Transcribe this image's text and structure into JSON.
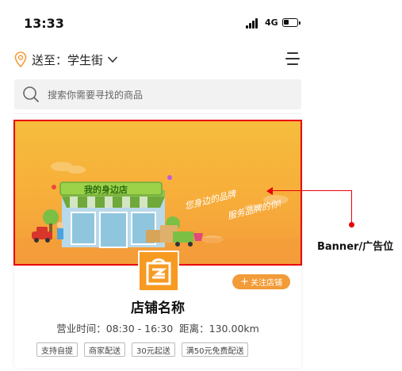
{
  "status_bar": {
    "time": "13:33",
    "network": "4G"
  },
  "location": {
    "prefix": "送至：",
    "address": "学生街"
  },
  "search": {
    "placeholder": "搜索你需要寻找的商品"
  },
  "banner": {
    "sign_text": "我的身边店",
    "slogan_line1": "您身边的品牌",
    "slogan_line2": "服务品牌的你!"
  },
  "annotation": {
    "label": "Banner/广告位",
    "color": "#e8000b"
  },
  "store": {
    "follow_label": "关注店铺",
    "name": "店铺名称",
    "hours_label": "营业时间：08:30 - 16:30",
    "distance_label": "距离：130.00km",
    "tags": [
      "支持自提",
      "商家配送",
      "30元起送",
      "满50元免费配送"
    ]
  },
  "colors": {
    "accent": "#f29b38",
    "banner": "#f7ad3a",
    "logo": "#f79a22"
  }
}
